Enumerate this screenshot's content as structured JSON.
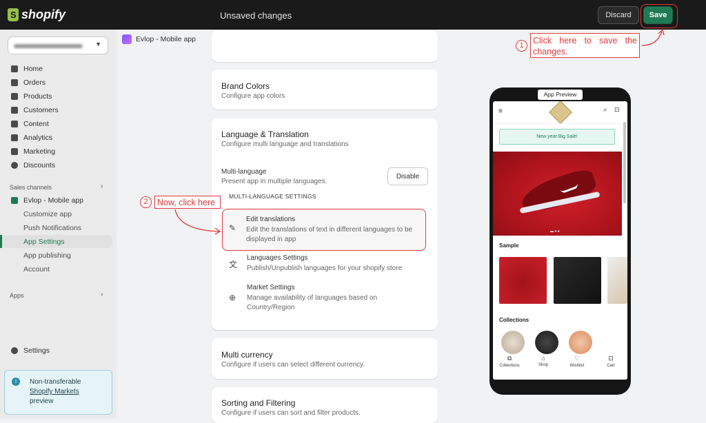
{
  "topbar": {
    "brand": "shopify",
    "status": "Unsaved changes",
    "discard_label": "Discard",
    "save_label": "Save"
  },
  "sidebar": {
    "nav": [
      {
        "label": "Home",
        "icon": "home-icon"
      },
      {
        "label": "Orders",
        "icon": "orders-icon"
      },
      {
        "label": "Products",
        "icon": "tag-icon"
      },
      {
        "label": "Customers",
        "icon": "person-icon"
      },
      {
        "label": "Content",
        "icon": "content-icon"
      },
      {
        "label": "Analytics",
        "icon": "bar-chart-icon"
      },
      {
        "label": "Marketing",
        "icon": "target-icon"
      },
      {
        "label": "Discounts",
        "icon": "discount-icon"
      }
    ],
    "sales_channels_label": "Sales channels",
    "channel_label": "Evlop - Mobile app",
    "channel_subitems": [
      "Customize app",
      "Push Notifications",
      "App Settings",
      "App publishing",
      "Account"
    ],
    "apps_label": "Apps",
    "settings_label": "Settings",
    "notice": {
      "line1": "Non-transferable",
      "link": "Shopify Markets",
      "line3": "preview"
    }
  },
  "breadcrumb": {
    "label": "Evlop - Mobile app"
  },
  "cards": {
    "brand": {
      "title": "Brand Colors",
      "subtitle": "Configure app colors"
    },
    "language": {
      "title": "Language & Translation",
      "subtitle": "Configure multi language and translations",
      "multi_label": "Multi-language",
      "multi_sub": "Present app in multiple languages.",
      "disable_label": "Disable",
      "settings_heading": "MULTI-LANGUAGE SETTINGS",
      "rows": [
        {
          "title": "Edit translations",
          "desc": "Edit the translations of text in different languages to be displayed in app"
        },
        {
          "title": "Languages Settings",
          "desc": "Publish/Unpublish languages for your shopify store"
        },
        {
          "title": "Market Settings",
          "desc": "Manage availability of languages based on Country/Region"
        }
      ]
    },
    "currency": {
      "title": "Multi currency",
      "subtitle": "Configure if users can select different currency."
    },
    "sorting": {
      "title": "Sorting and Filtering",
      "subtitle": "Configure if users can sort and filter products."
    }
  },
  "annotations": {
    "step1_num": "1",
    "step1_text": "Click here to save the changes.",
    "step2_num": "2",
    "step2_text": "Now, click here"
  },
  "preview": {
    "tag": "App Preview",
    "sale_banner": "New year Big Sale!",
    "section_sample": "Sample",
    "section_collections": "Collections",
    "tabs": [
      "Collections",
      "Shop",
      "Wishlist",
      "Cart"
    ]
  },
  "colors": {
    "accent": "#1f7a54",
    "annotation": "#e0383a",
    "hero_red": "#c81c24"
  }
}
